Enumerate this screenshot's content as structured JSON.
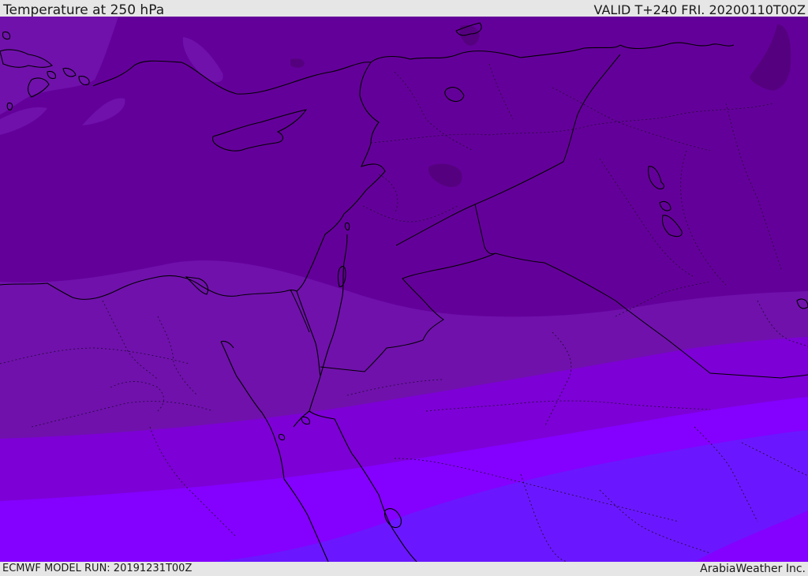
{
  "header": {
    "title": "Temperature at 250 hPa",
    "valid": "VALID T+240 FRI. 20200110T00Z"
  },
  "footer": {
    "model_run": "ECMWF MODEL RUN: 20191231T00Z",
    "credit": "ArabiaWeather Inc."
  },
  "colors": {
    "band_coldest": "#55007f",
    "band_1": "#64009a",
    "band_2": "#7011ac",
    "band_3": "#7d00d6",
    "band_4": "#8400ff",
    "band_5": "#6a17ff",
    "coastline": "#000000",
    "border": "#2a0a40"
  }
}
